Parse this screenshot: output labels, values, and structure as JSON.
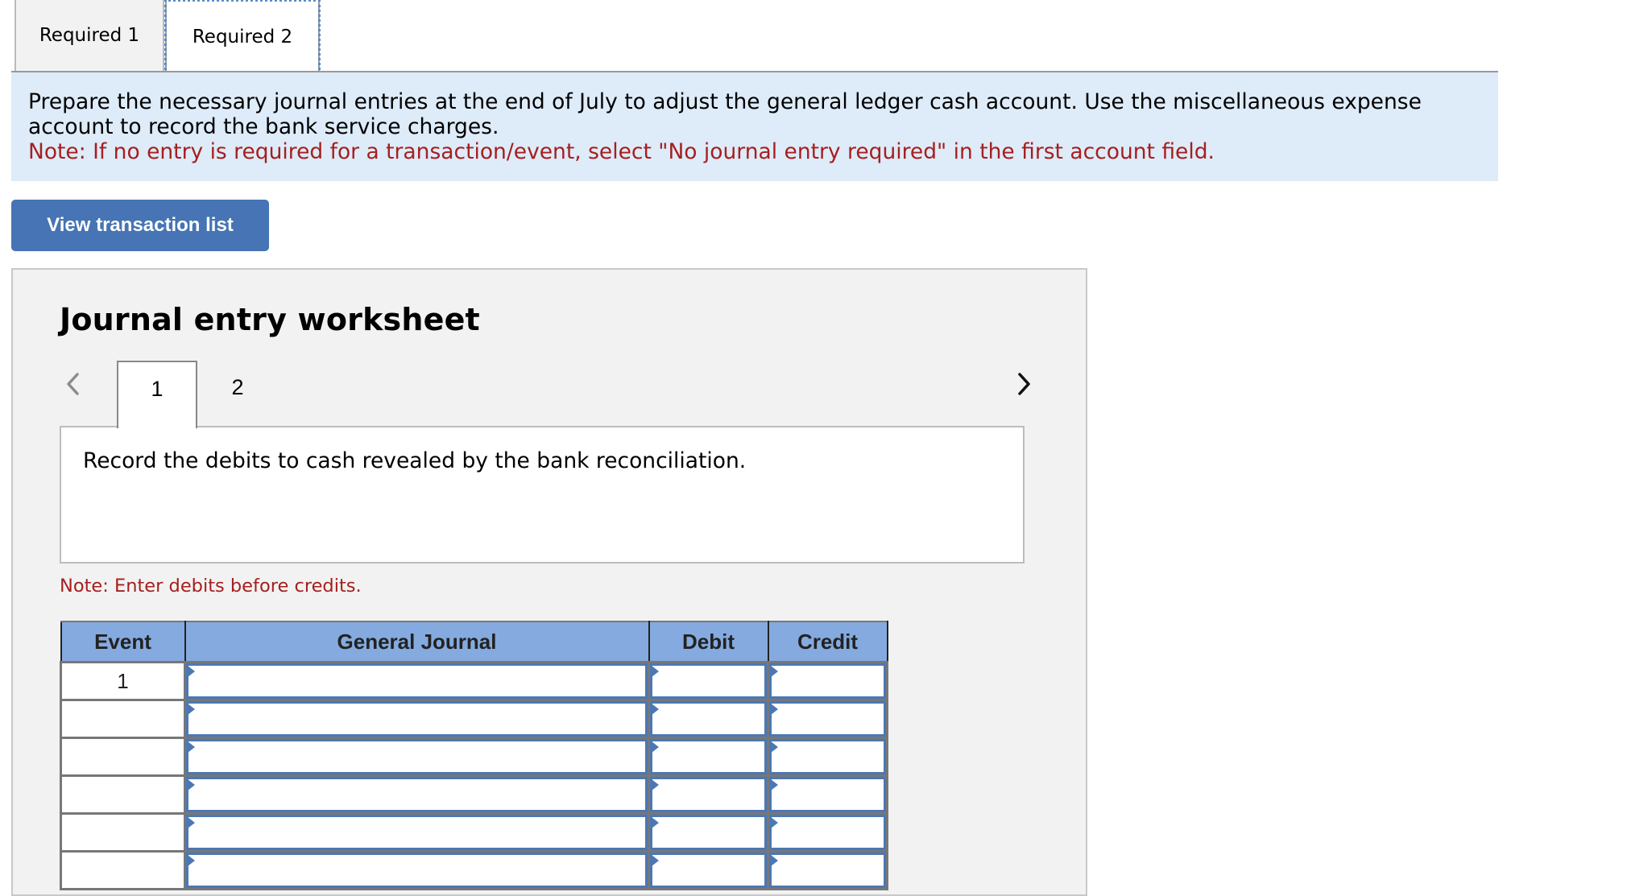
{
  "tabs": [
    {
      "label": "Required 1",
      "active": false
    },
    {
      "label": "Required 2",
      "active": true
    }
  ],
  "instructions": {
    "text": "Prepare the necessary journal entries at the end of July to adjust the general ledger cash account. Use the miscellaneous expense account to record the bank service charges.",
    "note": "Note: If no entry is required for a transaction/event, select \"No journal entry required\" in the first account field."
  },
  "view_transaction_button": "View transaction list",
  "worksheet": {
    "title": "Journal entry worksheet",
    "nav_prev_enabled": false,
    "nav_next_enabled": true,
    "entry_tabs": [
      {
        "label": "1",
        "active": true
      },
      {
        "label": "2",
        "active": false
      }
    ],
    "description": "Record the debits to cash revealed by the bank reconciliation.",
    "note": "Note: Enter debits before credits.",
    "table": {
      "headers": [
        "Event",
        "General Journal",
        "Debit",
        "Credit"
      ],
      "rows": [
        {
          "event": "1",
          "account": "",
          "debit": "",
          "credit": ""
        },
        {
          "event": "",
          "account": "",
          "debit": "",
          "credit": ""
        },
        {
          "event": "",
          "account": "",
          "debit": "",
          "credit": ""
        },
        {
          "event": "",
          "account": "",
          "debit": "",
          "credit": ""
        },
        {
          "event": "",
          "account": "",
          "debit": "",
          "credit": ""
        },
        {
          "event": "",
          "account": "",
          "debit": "",
          "credit": ""
        }
      ]
    }
  },
  "colors": {
    "accent_blue": "#4674b4",
    "header_blue": "#84aadf",
    "instructions_bg": "#deebf8",
    "note_red": "#a51f1f",
    "panel_bg": "#f2f2f2"
  }
}
